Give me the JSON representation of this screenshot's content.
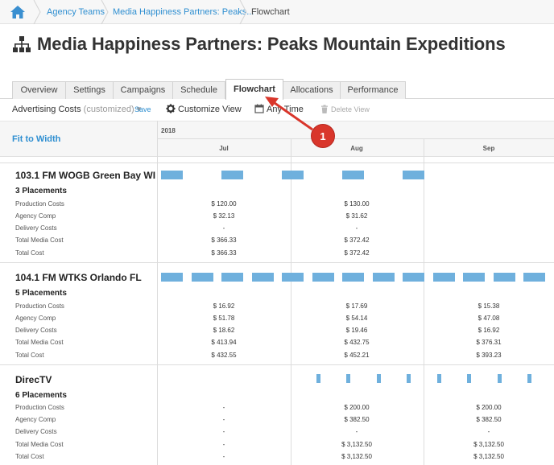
{
  "breadcrumb": {
    "items": [
      "Agency Teams",
      "Media Happiness Partners: Peaks...",
      "Flowchart"
    ]
  },
  "page": {
    "title": "Media Happiness Partners: Peaks Mountain Expeditions"
  },
  "tabs": [
    "Overview",
    "Settings",
    "Campaigns",
    "Schedule",
    "Flowchart",
    "Allocations",
    "Performance"
  ],
  "active_tab": "Flowchart",
  "toolbar": {
    "view_name": "Advertising Costs",
    "view_state": "(customized)",
    "save_label": "Save",
    "customize_label": "Customize View",
    "time_label": "Any Time",
    "delete_label": "Delete View"
  },
  "grid": {
    "fit_label": "Fit to Width",
    "year": "2018",
    "months": [
      "Jul",
      "Aug",
      "Sep"
    ],
    "row_labels": [
      "Production Costs",
      "Agency Comp",
      "Delivery Costs",
      "Total Media Cost",
      "Total Cost"
    ],
    "markets": [
      {
        "name": "103.1 FM WOGB Green Bay WI",
        "placements": "3 Placements",
        "values": [
          [
            "$ 120.00",
            "$ 130.00",
            ""
          ],
          [
            "$ 32.13",
            "$ 31.62",
            ""
          ],
          [
            "-",
            "-",
            ""
          ],
          [
            "$ 366.33",
            "$ 372.42",
            ""
          ],
          [
            "$ 366.33",
            "$ 372.42",
            ""
          ]
        ]
      },
      {
        "name": "104.1 FM WTKS Orlando FL",
        "placements": "5 Placements",
        "values": [
          [
            "$ 16.92",
            "$ 17.69",
            "$ 15.38"
          ],
          [
            "$ 51.78",
            "$ 54.14",
            "$ 47.08"
          ],
          [
            "$ 18.62",
            "$ 19.46",
            "$ 16.92"
          ],
          [
            "$ 413.94",
            "$ 432.75",
            "$ 376.31"
          ],
          [
            "$ 432.55",
            "$ 452.21",
            "$ 393.23"
          ]
        ]
      },
      {
        "name": "DirecTV",
        "placements": "6 Placements",
        "values": [
          [
            "-",
            "$ 200.00",
            "$ 200.00"
          ],
          [
            "-",
            "$ 382.50",
            "$ 382.50"
          ],
          [
            "-",
            "-",
            "-"
          ],
          [
            "-",
            "$ 3,132.50",
            "$ 3,132.50"
          ],
          [
            "-",
            "$ 3,132.50",
            "$ 3,132.50"
          ]
        ]
      }
    ]
  },
  "annotation": {
    "badge": "1"
  },
  "colors": {
    "accent": "#2f8fd1",
    "bar": "#6fb0dd",
    "annotation": "#d9362b"
  }
}
